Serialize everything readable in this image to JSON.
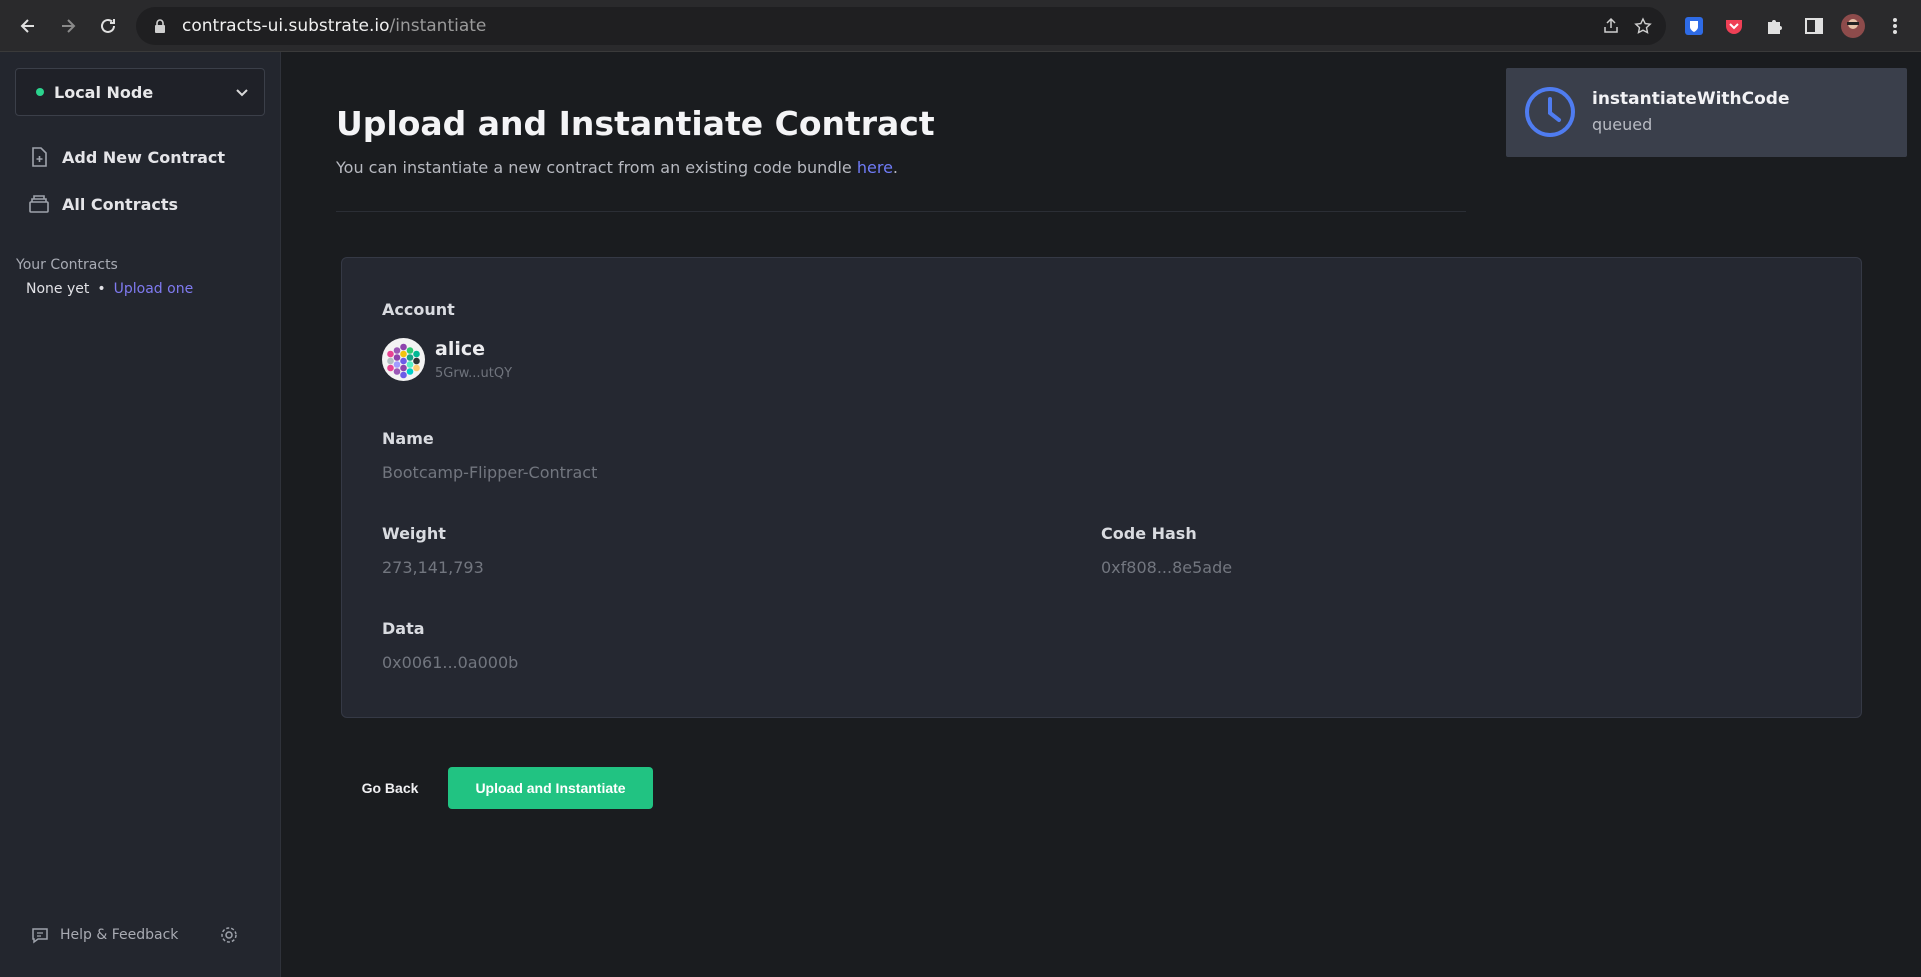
{
  "browser": {
    "url_host": "contracts-ui.substrate.io",
    "url_path": "/instantiate"
  },
  "sidebar": {
    "network": "Local Node",
    "links": [
      {
        "label": "Add New Contract",
        "icon": "add-document-icon"
      },
      {
        "label": "All Contracts",
        "icon": "archive-icon"
      }
    ],
    "your_contracts_heading": "Your Contracts",
    "none_yet": "None yet",
    "upload_one": "Upload one",
    "help": "Help & Feedback"
  },
  "main": {
    "title": "Upload and Instantiate Contract",
    "subtitle": "You can instantiate a new contract from an existing code bundle ",
    "subtitle_link": "here",
    "subtitle_end": "."
  },
  "form": {
    "account_label": "Account",
    "account_name": "alice",
    "account_address": "5Grw...utQY",
    "name_label": "Name",
    "name_value": "Bootcamp-Flipper-Contract",
    "weight_label": "Weight",
    "weight_value": "273,141,793",
    "code_hash_label": "Code Hash",
    "code_hash_value": "0xf808...8e5ade",
    "data_label": "Data",
    "data_value": "0x0061...0a000b"
  },
  "actions": {
    "back": "Go Back",
    "submit": "Upload and Instantiate"
  },
  "toast": {
    "title": "instantiateWithCode",
    "status": "queued"
  },
  "colors": {
    "accent_green": "#21c382",
    "link_blue": "#6f7bf6",
    "toast_clock": "#4f7cf0"
  }
}
